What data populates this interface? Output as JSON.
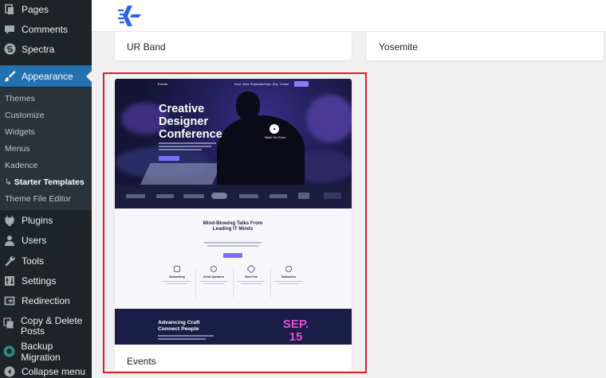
{
  "sidebar": {
    "items": [
      {
        "label": "Pages",
        "icon": "pages-icon"
      },
      {
        "label": "Comments",
        "icon": "comments-icon"
      },
      {
        "label": "Spectra",
        "icon": "spectra-icon"
      },
      {
        "label": "Appearance",
        "icon": "appearance-brush-icon",
        "active": true
      },
      {
        "label": "Plugins",
        "icon": "plugins-icon"
      },
      {
        "label": "Users",
        "icon": "users-icon"
      },
      {
        "label": "Tools",
        "icon": "tools-wrench-icon"
      },
      {
        "label": "Settings",
        "icon": "settings-icon"
      },
      {
        "label": "Redirection",
        "icon": "redirection-icon"
      },
      {
        "label": "Copy & Delete Posts",
        "icon": "copy-delete-posts-icon"
      },
      {
        "label": "Backup Migration",
        "icon": "backup-migration-icon"
      },
      {
        "label": "Collapse menu",
        "icon": "collapse-menu-icon"
      }
    ],
    "submenu": [
      {
        "label": "Themes"
      },
      {
        "label": "Customize"
      },
      {
        "label": "Widgets"
      },
      {
        "label": "Menus"
      },
      {
        "label": "Kadence"
      },
      {
        "label": "Starter Templates",
        "current": true
      },
      {
        "label": "Theme File Editor"
      }
    ]
  },
  "header": {
    "logo_icon": "starter-templates-logo-icon"
  },
  "cards": {
    "ur_band": {
      "title": "UR Band"
    },
    "yosemite": {
      "title": "Yosemite"
    },
    "events": {
      "title": "Events",
      "selected": true,
      "preview": {
        "nav_logo": "Events",
        "nav_links": [
          "Home",
          "About",
          "Registration",
          "Pages",
          "Blog",
          "Contact"
        ],
        "hero_title": "Creative Designer Conference",
        "play_caption": "Watch The Event",
        "talks_title": "Mind-Blowing Talks From Leading IT Minds",
        "features": [
          {
            "label": "Networking",
            "icon": "networking-icon"
          },
          {
            "label": "Great Speakers",
            "icon": "speakers-icon"
          },
          {
            "label": "Have Fun",
            "icon": "have-fun-icon"
          },
          {
            "label": "Motivation",
            "icon": "motivation-icon"
          }
        ],
        "dark_title": "Advancing Craft Connect People",
        "date_text": "SEP. 15"
      }
    }
  },
  "colors": {
    "sidebar_bg": "#1d2327",
    "submenu_bg": "#2c3338",
    "accent": "#2271b1",
    "selection_outline": "#e01d24",
    "date_pink": "#e84dd1"
  }
}
